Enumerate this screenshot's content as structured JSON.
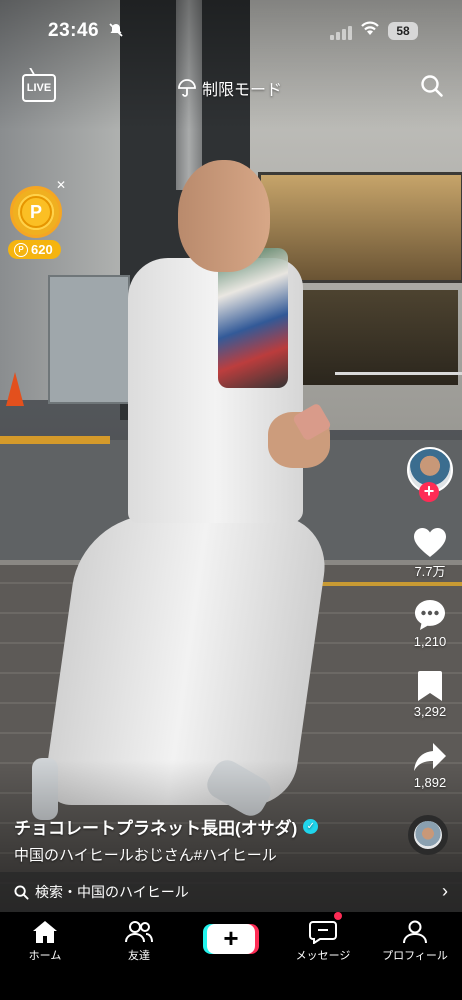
{
  "status_bar": {
    "time": "23:46",
    "battery": "58"
  },
  "header": {
    "live_label": "LIVE",
    "restricted_mode": "制限モード",
    "search_icon": "search-icon"
  },
  "reward_coin": {
    "count": "620"
  },
  "sidebar": {
    "likes": "7.7万",
    "comments": "1,210",
    "saves": "3,292",
    "shares": "1,892"
  },
  "video": {
    "author": "チョコレートプラネット長田(オサダ)",
    "description": "中国のハイヒールおじさん#ハイヒール"
  },
  "search_bar": {
    "label": "検索・中国のハイヒール"
  },
  "bottom_nav": {
    "home": "ホーム",
    "friends": "友達",
    "messages": "メッセージ",
    "profile": "プロフィール"
  },
  "colors": {
    "accent_red": "#fe2c55",
    "accent_cyan": "#25f4ee",
    "coin_gold": "#f5b40f",
    "verified_blue": "#20d5ec"
  }
}
